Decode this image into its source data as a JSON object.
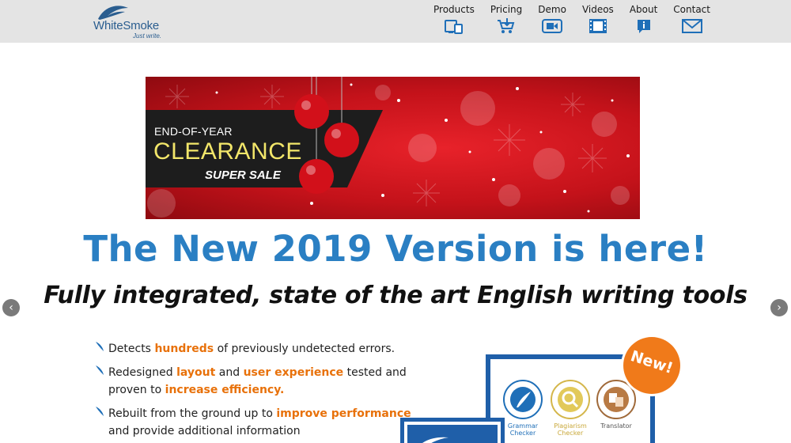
{
  "logo": {
    "name": "WhiteSmoke",
    "tagline": "Just write.",
    "icon": "feather-logo-icon"
  },
  "nav": {
    "items": [
      {
        "label": "Products",
        "icon": "devices-icon"
      },
      {
        "label": "Pricing",
        "icon": "cart-icon"
      },
      {
        "label": "Demo",
        "icon": "video-camera-icon"
      },
      {
        "label": "Videos",
        "icon": "film-icon"
      },
      {
        "label": "About",
        "icon": "info-icon"
      },
      {
        "label": "Contact",
        "icon": "mail-icon"
      }
    ]
  },
  "banner": {
    "line1": "END-OF-YEAR",
    "line2": "CLEARANCE",
    "line3": "SUPER SALE"
  },
  "hero": {
    "headline": "The New 2019 Version is here!",
    "subline": "Fully integrated, state of the art English writing tools"
  },
  "slider": {
    "prev_icon": "chevron-left-icon",
    "next_icon": "chevron-right-icon",
    "prev_glyph": "‹",
    "next_glyph": "›"
  },
  "features": [
    {
      "parts": [
        {
          "t": "Detects ",
          "h": false
        },
        {
          "t": "hundreds",
          "h": true
        },
        {
          "t": " of previously undetected errors.",
          "h": false
        }
      ]
    },
    {
      "parts": [
        {
          "t": "Redesigned ",
          "h": false
        },
        {
          "t": "layout",
          "h": true
        },
        {
          "t": " and ",
          "h": false
        },
        {
          "t": "user experience",
          "h": true
        },
        {
          "t": " tested and proven to ",
          "h": false
        },
        {
          "t": "increase efficiency.",
          "h": true
        }
      ]
    },
    {
      "parts": [
        {
          "t": "Rebuilt from the ground up to ",
          "h": false
        },
        {
          "t": "improve performance",
          "h": true
        },
        {
          "t": " and provide additional information",
          "h": false
        }
      ]
    }
  ],
  "product": {
    "tools": [
      {
        "label": "Grammar Checker",
        "icon": "quill-icon"
      },
      {
        "label": "Plagiarism Checker",
        "icon": "magnifier-icon"
      },
      {
        "label": "Translator",
        "icon": "translate-icon"
      }
    ],
    "badge": "New!"
  },
  "colors": {
    "brand_blue": "#2a7fc3",
    "accent_orange": "#e8710a",
    "banner_red": "#c4121a",
    "banner_yellow": "#f2e66a"
  }
}
